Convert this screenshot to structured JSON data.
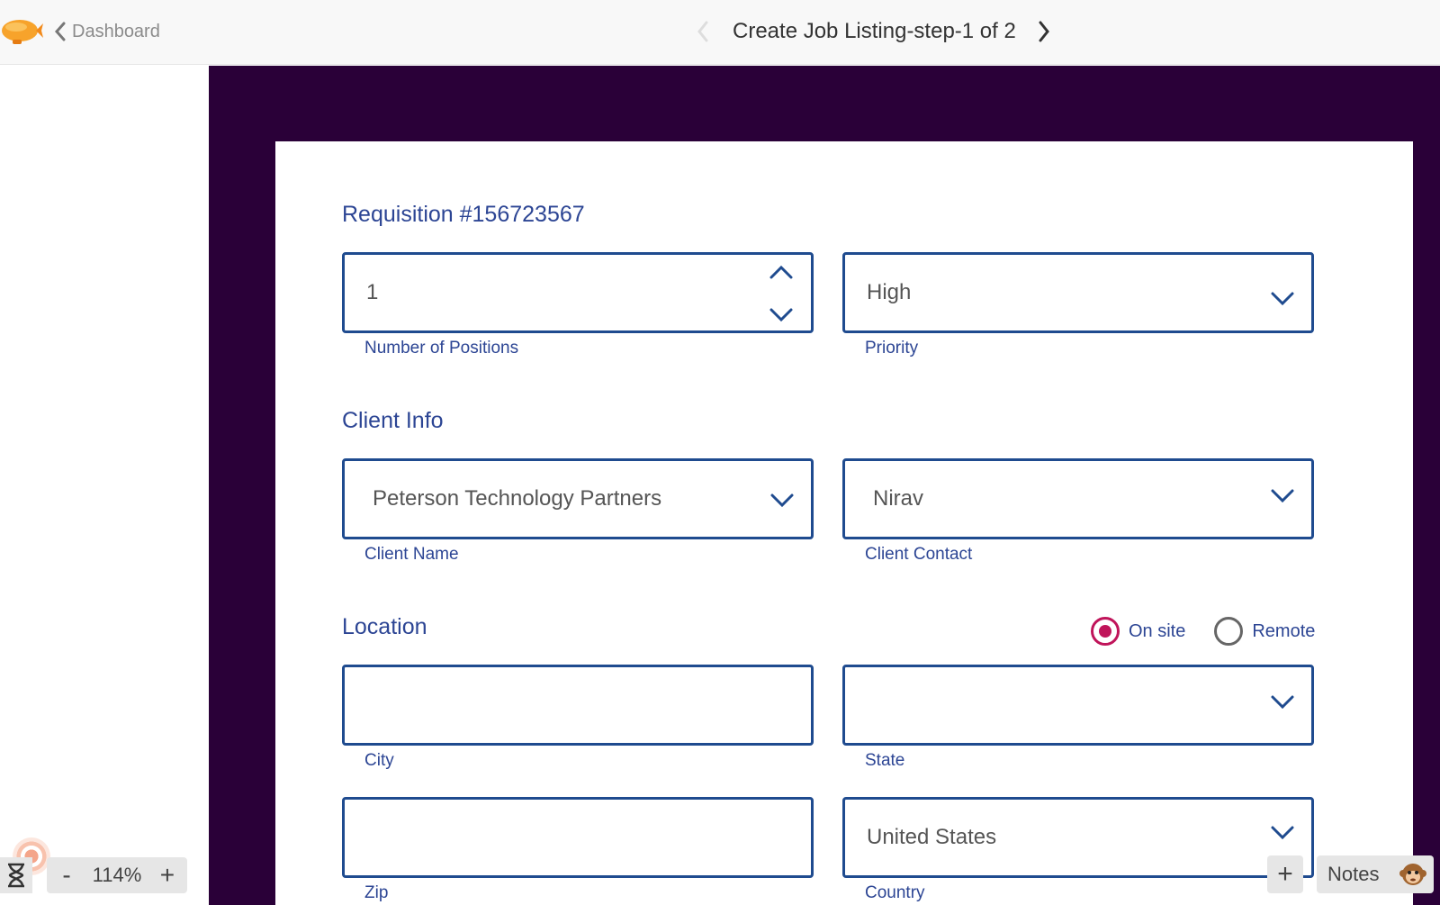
{
  "header": {
    "back_label": "Dashboard",
    "title": "Create Job Listing-step-1 of 2"
  },
  "form": {
    "requisition_title": "Requisition #156723567",
    "positions": {
      "value": "1",
      "label": "Number of Positions"
    },
    "priority": {
      "value": "High",
      "label": "Priority"
    },
    "client_section_title": "Client Info",
    "client_name": {
      "value": "Peterson Technology Partners",
      "label": "Client Name"
    },
    "client_contact": {
      "value": "Nirav",
      "label": "Client Contact"
    },
    "location_section_title": "Location",
    "location_type": {
      "options": [
        "On site",
        "Remote"
      ],
      "selected": "On site"
    },
    "city": {
      "value": "",
      "label": "City"
    },
    "state": {
      "value": "",
      "label": "State"
    },
    "zip": {
      "value": "",
      "label": "Zip"
    },
    "country": {
      "value": "United States",
      "label": "Country"
    }
  },
  "footer": {
    "zoom_level": "114%",
    "zoom_out_label": "-",
    "zoom_in_label": "+",
    "add_label": "+",
    "notes_label": "Notes"
  },
  "colors": {
    "accent_purple": "#2a0038",
    "field_border": "#1f4b8f",
    "label_blue": "#2c4594",
    "radio_selected": "#c0145a"
  },
  "icons": {
    "logo": "blimp-logo-icon",
    "back": "chevron-left-icon",
    "prev": "chevron-left-icon",
    "next": "chevron-right-icon",
    "dropdown": "chevron-down-icon",
    "stepper_up": "chevron-up-icon",
    "hourglass": "hourglass-icon",
    "notes_avatar": "monkey-icon"
  }
}
